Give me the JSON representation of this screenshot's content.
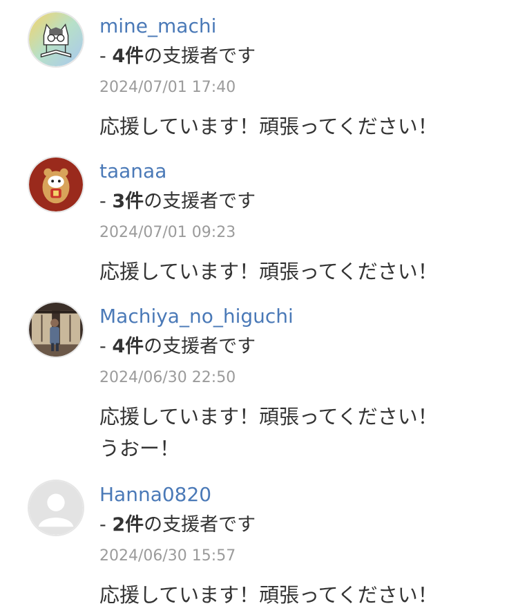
{
  "comments": [
    {
      "username": "mine_machi",
      "supporter_prefix": "- ",
      "supporter_count": "4件",
      "supporter_suffix": "の支援者です",
      "timestamp": "2024/07/01 17:40",
      "message_lines": [
        "応援しています！頑張ってください！"
      ],
      "avatar_icon": "cat-reading-avatar-icon"
    },
    {
      "username": "taanaa",
      "supporter_prefix": "- ",
      "supporter_count": "3件",
      "supporter_suffix": "の支援者です",
      "timestamp": "2024/07/01 09:23",
      "message_lines": [
        "応援しています！頑張ってください！"
      ],
      "avatar_icon": "daruma-avatar-icon"
    },
    {
      "username": "Machiya_no_higuchi",
      "supporter_prefix": "- ",
      "supporter_count": "4件",
      "supporter_suffix": "の支援者です",
      "timestamp": "2024/06/30 22:50",
      "message_lines": [
        "応援しています！頑張ってください！",
        "うおー！"
      ],
      "avatar_icon": "person-photo-avatar-icon"
    },
    {
      "username": "Hanna0820",
      "supporter_prefix": "- ",
      "supporter_count": "2件",
      "supporter_suffix": "の支援者です",
      "timestamp": "2024/06/30 15:57",
      "message_lines": [
        "応援しています！頑張ってください！"
      ],
      "avatar_icon": "default-user-avatar-icon"
    }
  ],
  "colors": {
    "username": "#4a79b7",
    "text": "#333333",
    "timestamp": "#9b9b9b"
  }
}
